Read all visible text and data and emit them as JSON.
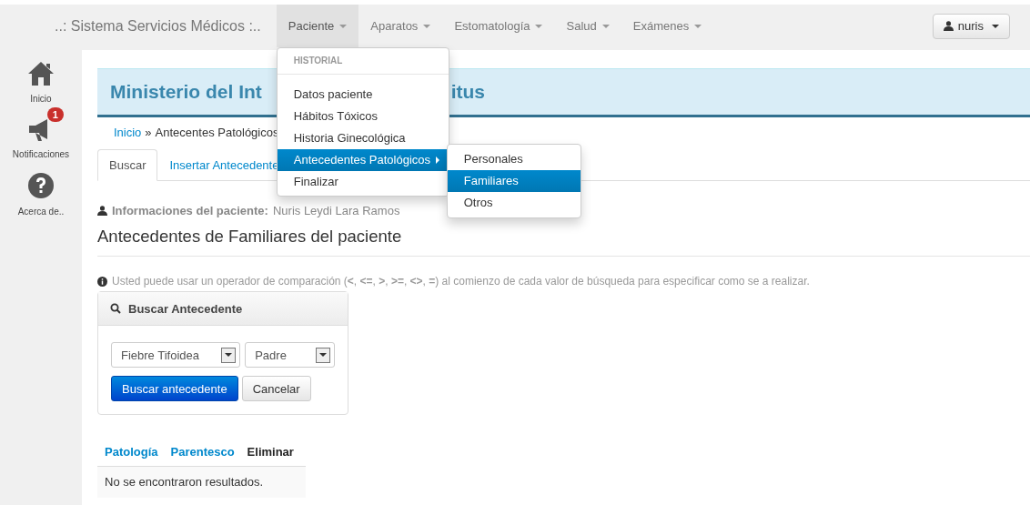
{
  "navbar": {
    "brand": "..: Sistema Servicios Médicos :..",
    "menus": [
      {
        "label": "Paciente",
        "selected": true
      },
      {
        "label": "Aparatos",
        "selected": false
      },
      {
        "label": "Estomatología",
        "selected": false
      },
      {
        "label": "Salud",
        "selected": false
      },
      {
        "label": "Exámenes",
        "selected": false
      }
    ],
    "user": "nuris"
  },
  "dropdown": {
    "header": "HISTORIAL",
    "items": [
      {
        "label": "Datos paciente",
        "selected": false
      },
      {
        "label": "Hábitos Tóxicos",
        "selected": false
      },
      {
        "label": "Historia Ginecológica",
        "selected": false
      },
      {
        "label": "Antecedentes Patológicos",
        "selected": true,
        "submenu": [
          {
            "label": "Personales",
            "selected": false
          },
          {
            "label": "Familiares",
            "selected": true
          },
          {
            "label": "Otros",
            "selected": false
          }
        ]
      },
      {
        "label": "Finalizar",
        "selected": false
      }
    ]
  },
  "sidebar": {
    "items": [
      {
        "label": "Inicio"
      },
      {
        "label": "Notificaciones",
        "badge": "1"
      },
      {
        "label": "Acerca de.."
      }
    ]
  },
  "banner": {
    "title_parts": [
      "Ministerio del Int",
      "itus"
    ]
  },
  "breadcrumb": {
    "link": "Inicio",
    "separator": "»",
    "current": "Antecentes Patológicos"
  },
  "tabs": [
    {
      "label": "Buscar",
      "selected": true
    },
    {
      "label": "Insertar Antecedente",
      "selected": false
    }
  ],
  "patient_info": {
    "label": "Informaciones del paciente:",
    "value": "Nuris Leydi Lara Ramos"
  },
  "heading": "Antecedentes de Familiares del paciente",
  "note": "Usted puede usar un operador de comparación (**<**, **<=**, **>**, **>=**, **<>**, **=**) al comienzo de cada valor de búsqueda para especificar como se a realizar.",
  "search_panel": {
    "title": "Buscar Antecedente",
    "selects": [
      {
        "value": "Fiebre Tifoidea"
      },
      {
        "value": "Padre"
      }
    ],
    "buttons": [
      {
        "label": "Buscar antecedente",
        "kind": "primary"
      },
      {
        "label": "Cancelar",
        "kind": "default"
      }
    ]
  },
  "table": {
    "columns": [
      {
        "label": "Patología",
        "sortable": true
      },
      {
        "label": "Parentesco",
        "sortable": true
      },
      {
        "label": "Eliminar",
        "sortable": false
      }
    ],
    "empty_message": "No se encontraron resultados."
  }
}
